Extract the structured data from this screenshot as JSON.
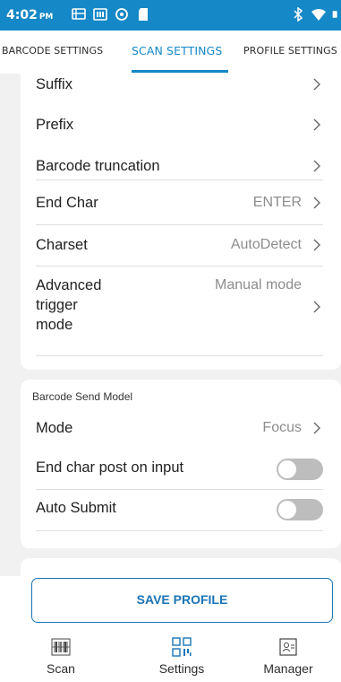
{
  "status_bar": {
    "time": "4:02",
    "ampm": "PM"
  },
  "tabs": [
    {
      "label": "BARCODE SETTINGS",
      "active": false
    },
    {
      "label": "SCAN SETTINGS",
      "active": true
    },
    {
      "label": "PROFILE SETTINGS",
      "active": false
    }
  ],
  "settings": {
    "suffix": {
      "label": "Suffix"
    },
    "prefix": {
      "label": "Prefix"
    },
    "barcode_truncation": {
      "label": "Barcode truncation"
    },
    "end_char": {
      "label": "End Char",
      "value": "ENTER"
    },
    "charset": {
      "label": "Charset",
      "value": "AutoDetect"
    },
    "advanced_trigger": {
      "label_line1": "Advanced",
      "label_line2": "trigger",
      "label_line3": "mode",
      "value": "Manual mode"
    }
  },
  "barcode_send_model": {
    "title": "Barcode Send Model",
    "mode": {
      "label": "Mode",
      "value": "Focus"
    },
    "end_char_post": {
      "label": "End char post on input",
      "enabled": false
    },
    "auto_submit": {
      "label": "Auto Submit",
      "enabled": false
    }
  },
  "save_button": {
    "label": "SAVE PROFILE"
  },
  "bottom_nav": [
    {
      "label": "Scan",
      "icon": "barcode-icon"
    },
    {
      "label": "Settings",
      "icon": "qr-code-icon"
    },
    {
      "label": "Manager",
      "icon": "profile-card-icon"
    }
  ],
  "colors": {
    "primary": "#1588c7",
    "button_border": "#1a74b6"
  }
}
